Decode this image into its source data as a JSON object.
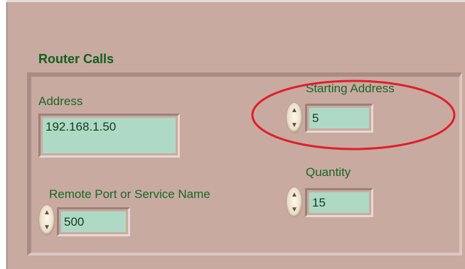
{
  "section": {
    "title": "Router Calls"
  },
  "controls": {
    "address": {
      "label": "Address",
      "value": "192.168.1.50"
    },
    "remote_port": {
      "label": "Remote Port or Service Name",
      "value": "500"
    },
    "starting_address": {
      "label": "Starting Address",
      "value": "5"
    },
    "quantity": {
      "label": "Quantity",
      "value": "15"
    }
  },
  "icons": {
    "spinner_up": "▲",
    "spinner_down": "▼"
  },
  "colors": {
    "panel": "#c8aaa0",
    "field": "#aedac5",
    "label_text": "#19672a",
    "value_text": "#153b1e",
    "highlight": "#e01f2a"
  }
}
